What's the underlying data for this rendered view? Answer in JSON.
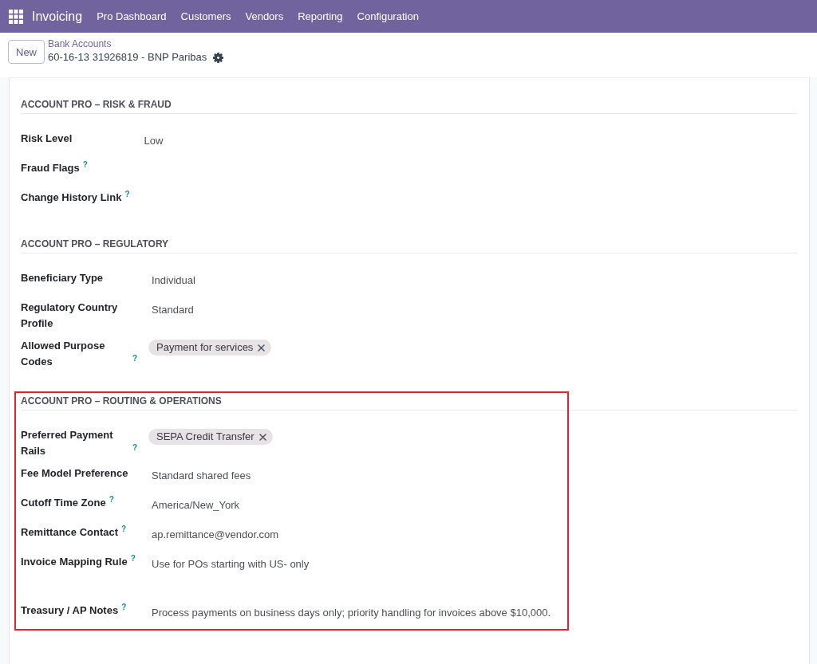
{
  "navbar": {
    "app_name": "Invoicing",
    "menu": [
      {
        "label": "Pro Dashboard"
      },
      {
        "label": "Customers"
      },
      {
        "label": "Vendors"
      },
      {
        "label": "Reporting"
      },
      {
        "label": "Configuration"
      }
    ]
  },
  "control_panel": {
    "new_button": "New",
    "breadcrumb": "Bank Accounts",
    "record_title": "60-16-13 31926819 - BNP Paribas"
  },
  "sections": [
    {
      "title": "ACCOUNT PRO – RISK & FRAUD",
      "highlighted": false,
      "fields": [
        {
          "label": "Risk Level",
          "kind": "char",
          "value": "Low"
        },
        {
          "label": "Fraud Flags",
          "help": "?",
          "kind": "char"
        },
        {
          "label": "Change History Link",
          "help": "?",
          "kind": "char"
        }
      ]
    },
    {
      "title": "ACCOUNT PRO – REGULATORY",
      "highlighted": false,
      "fields": [
        {
          "label": "Beneficiary Type",
          "kind": "char",
          "value": "Individual"
        },
        {
          "label": "Regulatory Country Profile",
          "kind": "char",
          "value": "Standard"
        },
        {
          "label": "Allowed Purpose Codes",
          "help": "?",
          "kind": "tags",
          "tags": [
            {
              "label": "Payment for services"
            }
          ]
        }
      ]
    },
    {
      "title": "ACCOUNT PRO – ROUTING & OPERATIONS",
      "highlighted": true,
      "fields": [
        {
          "label": "Preferred Payment Rails",
          "help": "?",
          "kind": "tags",
          "tags": [
            {
              "label": "SEPA Credit Transfer"
            }
          ]
        },
        {
          "label": "Fee Model Preference",
          "kind": "char",
          "value": "Standard shared fees"
        },
        {
          "label": "Cutoff Time Zone",
          "help": "?",
          "kind": "char",
          "value": "America/New_York"
        },
        {
          "label": "Remittance Contact",
          "help": "?",
          "kind": "char",
          "value": "ap.remittance@vendor.com"
        },
        {
          "label": "Invoice Mapping Rule",
          "help": "?",
          "kind": "text",
          "value": "Use for POs starting with US- only"
        },
        {
          "label": "Treasury / AP Notes",
          "help": "?",
          "kind": "text",
          "value": "Process payments on business days only; priority handling for invoices above $10,000."
        }
      ]
    }
  ]
}
